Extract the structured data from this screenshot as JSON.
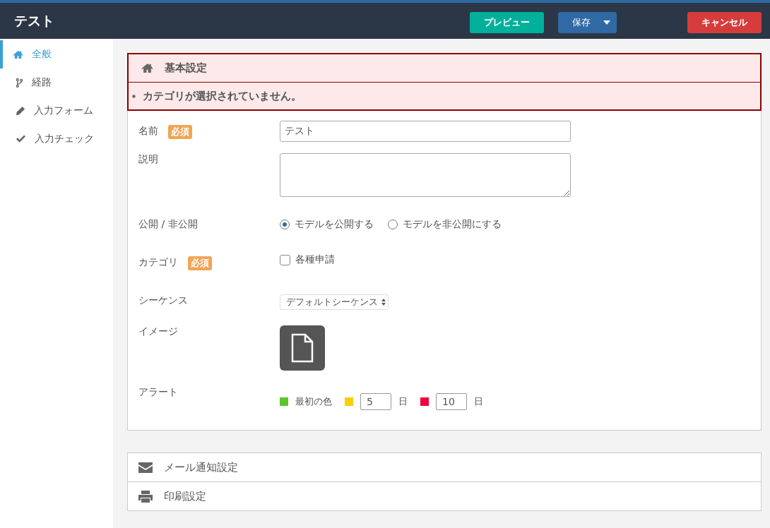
{
  "header": {
    "title": "テスト",
    "buttons": [
      {
        "kind": "preview",
        "label": "プレビュー"
      },
      {
        "kind": "split",
        "label": "保存"
      },
      {
        "kind": "danger",
        "label": "キャンセル"
      }
    ]
  },
  "sidebar": {
    "items": [
      {
        "label": "全般",
        "selected": true
      },
      {
        "label": "経路",
        "selected": false
      },
      {
        "label": "入力フォーム",
        "selected": false
      },
      {
        "label": "入力チェック",
        "selected": false
      }
    ]
  },
  "section": {
    "title": "基本設定",
    "errors": [
      "カテゴリが選択されていません。"
    ],
    "fields": [
      {
        "kind": "text",
        "label": "名前",
        "badge": "必須",
        "value": "テスト"
      },
      {
        "kind": "textarea",
        "label": "説明"
      },
      {
        "kind": "radio",
        "label": "公開 / 非公開",
        "options": [
          {
            "label": "モデルを公開する",
            "selected": true
          },
          {
            "label": "モデルを非公開にする",
            "selected": false
          }
        ]
      },
      {
        "kind": "checkbox",
        "label": "カテゴリ",
        "badge": "必須",
        "options": [
          {
            "label": "各種申請",
            "checked": false
          }
        ]
      },
      {
        "kind": "select",
        "label": "シーケンス",
        "value": "デフォルトシーケンス"
      },
      {
        "kind": "image",
        "label": "イメージ"
      },
      {
        "kind": "alert",
        "label": "アラート",
        "levels": [
          {
            "color": "#5ac62a",
            "label": "最初の色"
          },
          {
            "color": "#f8cf00",
            "value": "5",
            "unit": "日"
          },
          {
            "color": "#f0003c",
            "value": "10",
            "unit": "日"
          }
        ]
      }
    ]
  },
  "accordion": [
    {
      "label": "メール通知設定"
    },
    {
      "label": "印刷設定"
    }
  ]
}
